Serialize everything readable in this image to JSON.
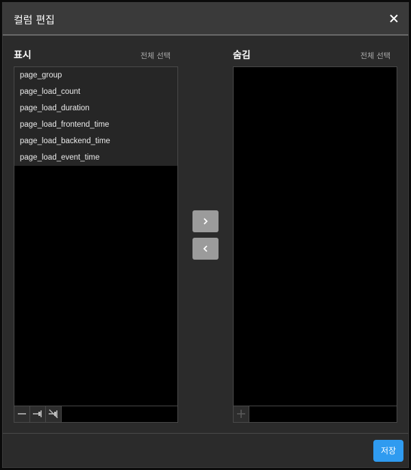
{
  "dialog": {
    "title": "컬럼 편집",
    "save_label": "저장"
  },
  "visible_panel": {
    "title": "표시",
    "select_all": "전체 선택",
    "items": [
      {
        "label": "page_group"
      },
      {
        "label": "page_load_count"
      },
      {
        "label": "page_load_duration"
      },
      {
        "label": "page_load_frontend_time"
      },
      {
        "label": "page_load_backend_time"
      },
      {
        "label": "page_load_event_time"
      }
    ]
  },
  "hidden_panel": {
    "title": "숨김",
    "select_all": "전체 선택",
    "items": []
  },
  "icons": {
    "close": "close-icon",
    "move_right": "chevron-right-icon",
    "move_left": "chevron-left-icon",
    "remove": "minus-icon",
    "pin": "pin-icon",
    "unpin": "unpin-icon",
    "add": "plus-icon"
  },
  "colors": {
    "accent": "#2f9bf0",
    "dialog_bg": "#2b2b2b",
    "list_bg": "#000000",
    "move_button": "#9b9b9b"
  }
}
